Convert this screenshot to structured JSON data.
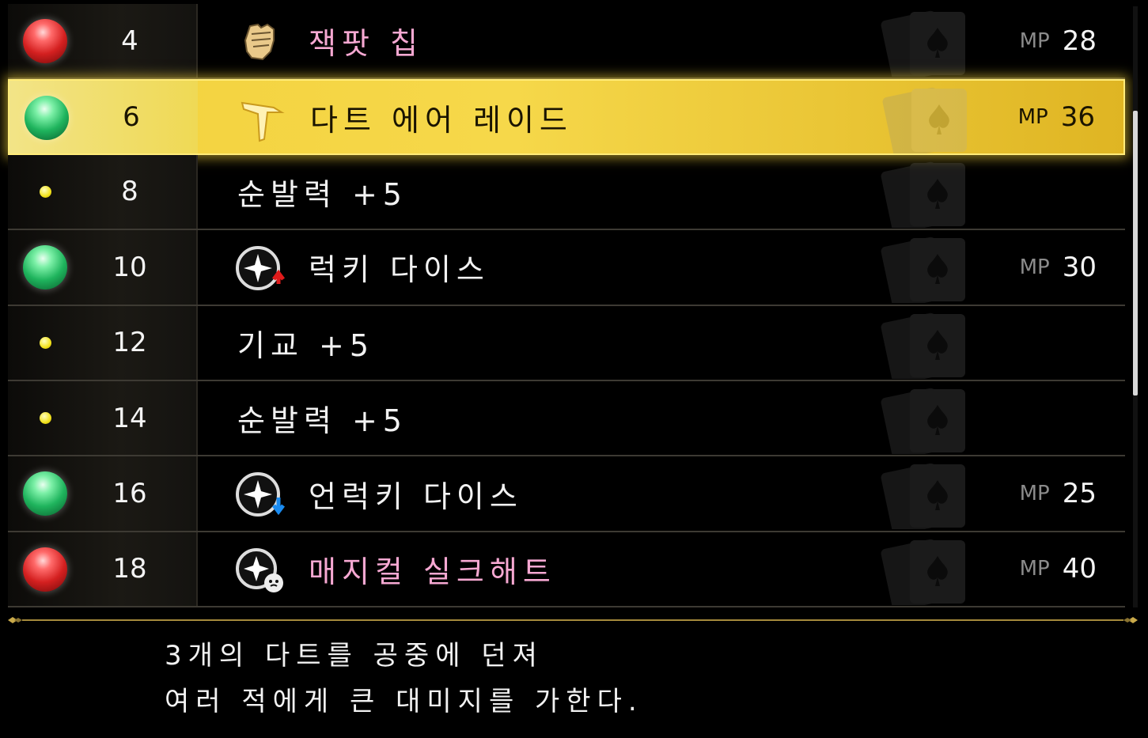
{
  "colors": {
    "accent_gold": "#f3d13c",
    "skill_pink": "#f6a8d2",
    "mp_label": "#8b8b8b"
  },
  "skills": [
    {
      "level": "4",
      "orb": "red",
      "icon": "fist-icon",
      "name": "잭팟 칩",
      "pink": true,
      "mp_label": "MP",
      "mp": "28"
    },
    {
      "level": "6",
      "orb": "green",
      "icon": "dart-icon",
      "name": "다트 에어 레이드",
      "pink": false,
      "mp_label": "MP",
      "mp": "36",
      "selected": true
    },
    {
      "level": "8",
      "orb": "dot",
      "icon": "",
      "name": "순발력 +5",
      "pink": false,
      "mp_label": "",
      "mp": ""
    },
    {
      "level": "10",
      "orb": "green",
      "icon": "lucky-dice-icon",
      "name": "럭키 다이스",
      "pink": false,
      "mp_label": "MP",
      "mp": "30"
    },
    {
      "level": "12",
      "orb": "dot",
      "icon": "",
      "name": "기교 +5",
      "pink": false,
      "mp_label": "",
      "mp": ""
    },
    {
      "level": "14",
      "orb": "dot",
      "icon": "",
      "name": "순발력 +5",
      "pink": false,
      "mp_label": "",
      "mp": ""
    },
    {
      "level": "16",
      "orb": "green",
      "icon": "unlucky-dice-icon",
      "name": "언럭키 다이스",
      "pink": false,
      "mp_label": "MP",
      "mp": "25"
    },
    {
      "level": "18",
      "orb": "red",
      "icon": "silk-hat-icon",
      "name": "매지컬 실크해트",
      "pink": true,
      "mp_label": "MP",
      "mp": "40"
    }
  ],
  "description": {
    "line1": "3개의 다트를 공중에 던져",
    "line2": "여러 적에게 큰 대미지를 가한다."
  }
}
